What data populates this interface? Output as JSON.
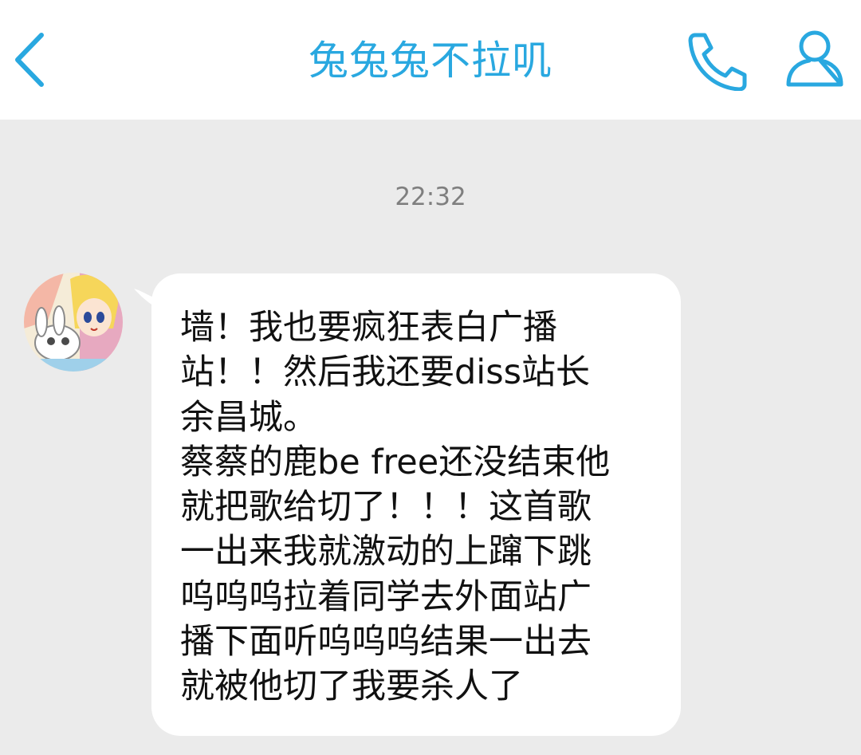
{
  "header": {
    "title": "兔兔兔不拉叽",
    "back_icon": "chevron-left-icon",
    "call_icon": "phone-icon",
    "profile_icon": "person-icon",
    "accent_color": "#29a8e0"
  },
  "chat": {
    "timestamp": "22:32",
    "messages": [
      {
        "direction": "incoming",
        "text": "墙！我也要疯狂表白广播\n站！！然后我还要diss站长\n余昌城。\n蔡蔡的鹿be free还没结束他\n就把歌给切了！！！这首歌\n一出来我就激动的上蹿下跳\n呜呜呜拉着同学去外面站广\n播下面听呜呜呜结果一出去\n就被他切了我要杀人了"
      }
    ]
  }
}
